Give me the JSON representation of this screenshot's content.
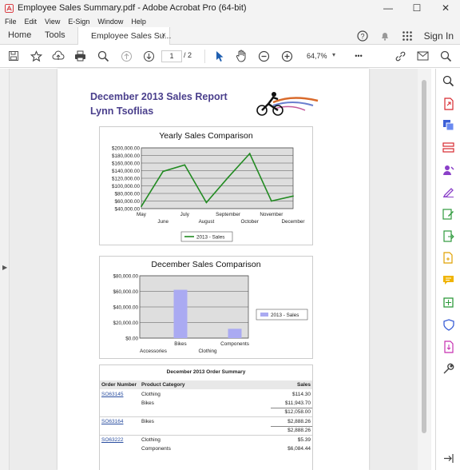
{
  "window": {
    "title": "Employee Sales Summary.pdf - Adobe Acrobat Pro (64-bit)",
    "minimize": "—",
    "maximize": "☐",
    "close": "✕"
  },
  "menu": [
    "File",
    "Edit",
    "View",
    "E-Sign",
    "Window",
    "Help"
  ],
  "tabs": {
    "home": "Home",
    "tools": "Tools",
    "document": "Employee Sales Su...",
    "close": "×",
    "signin": "Sign In"
  },
  "toolbar": {
    "page_current": "1",
    "page_total": "/  2",
    "zoom": "64,7%",
    "more": "•••"
  },
  "report": {
    "title": "December 2013 Sales Report",
    "author": "Lynn Tsoflias"
  },
  "chart_data": [
    {
      "type": "line",
      "title": "Yearly Sales Comparison",
      "x": [
        "May",
        "June",
        "July",
        "August",
        "September",
        "October",
        "November",
        "December"
      ],
      "series": [
        {
          "name": "2013 - Sales",
          "values": [
            46000,
            138000,
            155000,
            56000,
            122000,
            185000,
            60000,
            73000
          ]
        }
      ],
      "yticks": [
        "$200,000.00",
        "$180,000.00",
        "$160,000.00",
        "$140,000.00",
        "$120,000.00",
        "$100,000.00",
        "$80,000.00",
        "$60,000.00",
        "$40,000.00"
      ],
      "ylim": [
        40000,
        200000
      ],
      "grid": true,
      "legend": "bottom",
      "color": "#228b22"
    },
    {
      "type": "bar",
      "title": "December Sales Comparison",
      "categories": [
        "Accessories",
        "Bikes",
        "Clothing",
        "Components"
      ],
      "series": [
        {
          "name": "2013 - Sales",
          "values": [
            0,
            62000,
            0,
            12000
          ]
        }
      ],
      "yticks": [
        "$80,000.00",
        "$60,000.00",
        "$40,000.00",
        "$20,000.00",
        "$0.00"
      ],
      "ylim": [
        0,
        80000
      ],
      "grid": true,
      "legend": "right",
      "color": "#aaaaf2"
    }
  ],
  "order_summary": {
    "title": "December 2013 Order Summary",
    "headers": {
      "order": "Order Number",
      "category": "Product Category",
      "sales": "Sales"
    },
    "rows": [
      {
        "order": "SO63145",
        "category": "Clothing",
        "sales": "$114.30"
      },
      {
        "order": "",
        "category": "Bikes",
        "sales": "$11,943.70"
      },
      {
        "order": "",
        "category": "",
        "sales": "$12,058.00"
      },
      {
        "order": "SO63164",
        "category": "Bikes",
        "sales": "$2,888.26"
      },
      {
        "order": "",
        "category": "",
        "sales": "$2,888.26"
      },
      {
        "order": "SO63222",
        "category": "Clothing",
        "sales": "$5.39"
      },
      {
        "order": "",
        "category": "Components",
        "sales": "$6,084.44"
      }
    ]
  },
  "colors": {
    "accent": "#4a3f8c",
    "link": "#2a4ea0",
    "acrobat_red": "#d7282f"
  }
}
